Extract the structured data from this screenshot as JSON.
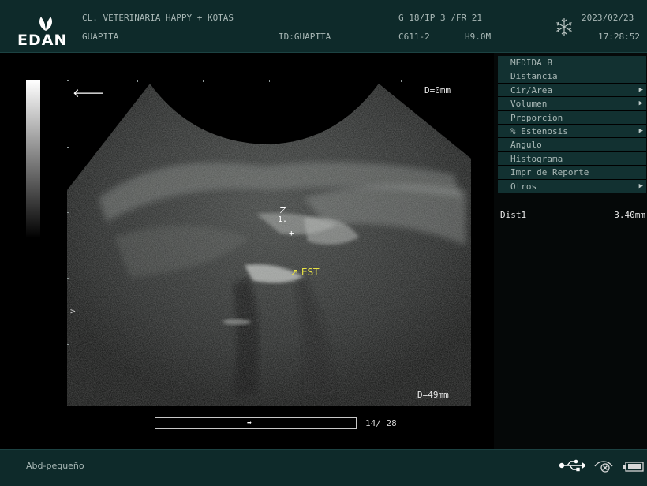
{
  "header": {
    "logo_text": "EDAN",
    "clinic": "CL. VETERINARIA HAPPY + KOTAS",
    "patient": "GUAPITA",
    "patient_id": "ID:GUAPITA",
    "gain": "G 18/IP 3 /FR 21",
    "probe": "C611-2",
    "freq": "H9.0M",
    "date": "2023/02/23",
    "time": "17:28:52"
  },
  "image": {
    "depth_top": "D=0mm",
    "depth_bottom": "D=49mm",
    "marker_label": "1.",
    "annotation": "EST",
    "focus_marker": ">",
    "frame_counter": "14/ 28"
  },
  "menu": {
    "items": [
      {
        "label": "MEDIDA B",
        "arrow": false
      },
      {
        "label": "Distancia",
        "arrow": false
      },
      {
        "label": "Cir/Area",
        "arrow": true
      },
      {
        "label": "Volumen",
        "arrow": true
      },
      {
        "label": "Proporcion",
        "arrow": false
      },
      {
        "label": "% Estenosis",
        "arrow": true
      },
      {
        "label": "Angulo",
        "arrow": false
      },
      {
        "label": "Histograma",
        "arrow": false
      },
      {
        "label": "Impr de Reporte",
        "arrow": false
      },
      {
        "label": "Otros",
        "arrow": true
      }
    ]
  },
  "results": {
    "name": "Dist1",
    "value": "3.40mm"
  },
  "footer": {
    "preset": "Abd-pequeño"
  },
  "icons": {
    "logo": "leaf-logo-icon",
    "freeze": "snowflake-icon",
    "usb": "usb-icon",
    "printer": "printer-icon",
    "battery": "battery-icon"
  },
  "colors": {
    "bar_bg": "#0e2a2a",
    "menu_bg": "#123131",
    "annotation": "#e9e344"
  }
}
